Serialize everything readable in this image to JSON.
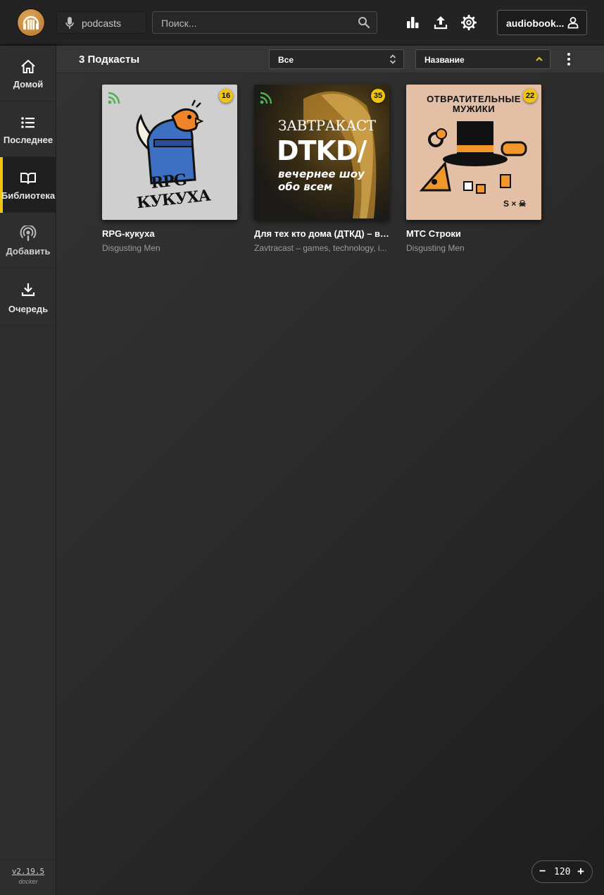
{
  "header": {
    "library_label": "podcasts",
    "search_placeholder": "Поиск...",
    "user_label": "audiobook..."
  },
  "sidebar": {
    "items": [
      {
        "label": "Домой",
        "icon": "home-icon"
      },
      {
        "label": "Последнее",
        "icon": "list-icon"
      },
      {
        "label": "Библиотека",
        "icon": "book-open-icon"
      },
      {
        "label": "Добавить",
        "icon": "podcast-icon"
      },
      {
        "label": "Очередь",
        "icon": "download-icon"
      }
    ],
    "active_index": 2,
    "version": "v2.19.5",
    "build": "docker"
  },
  "toolbar": {
    "count_label": "3 Подкасты",
    "filter_value": "Все",
    "sort_value": "Название"
  },
  "podcasts": [
    {
      "title": "RPG-кукуха",
      "author": "Disgusting Men",
      "episodes": "16",
      "cover_text": "RPG-КУКУХА"
    },
    {
      "title": "Для тех кто дома (ДТКД) – ве...",
      "author": "Zavtracast – games, technology, i...",
      "episodes": "35",
      "cover_text": "ЗАВТРАКАСТ",
      "cover_text2": "DTKD/",
      "cover_text3": "вечернее шоу",
      "cover_text4": "обо всем"
    },
    {
      "title": "МТС Строки",
      "author": "Disgusting Men",
      "episodes": "22",
      "cover_text": "ОТВРАТИТЕЛЬНЫЕ",
      "cover_text2": "МУЖИКИ"
    }
  ],
  "zoom": {
    "minus": "−",
    "value": "120",
    "plus": "+"
  },
  "colors": {
    "accent": "#f1c40f",
    "rss": "#4caf50"
  }
}
